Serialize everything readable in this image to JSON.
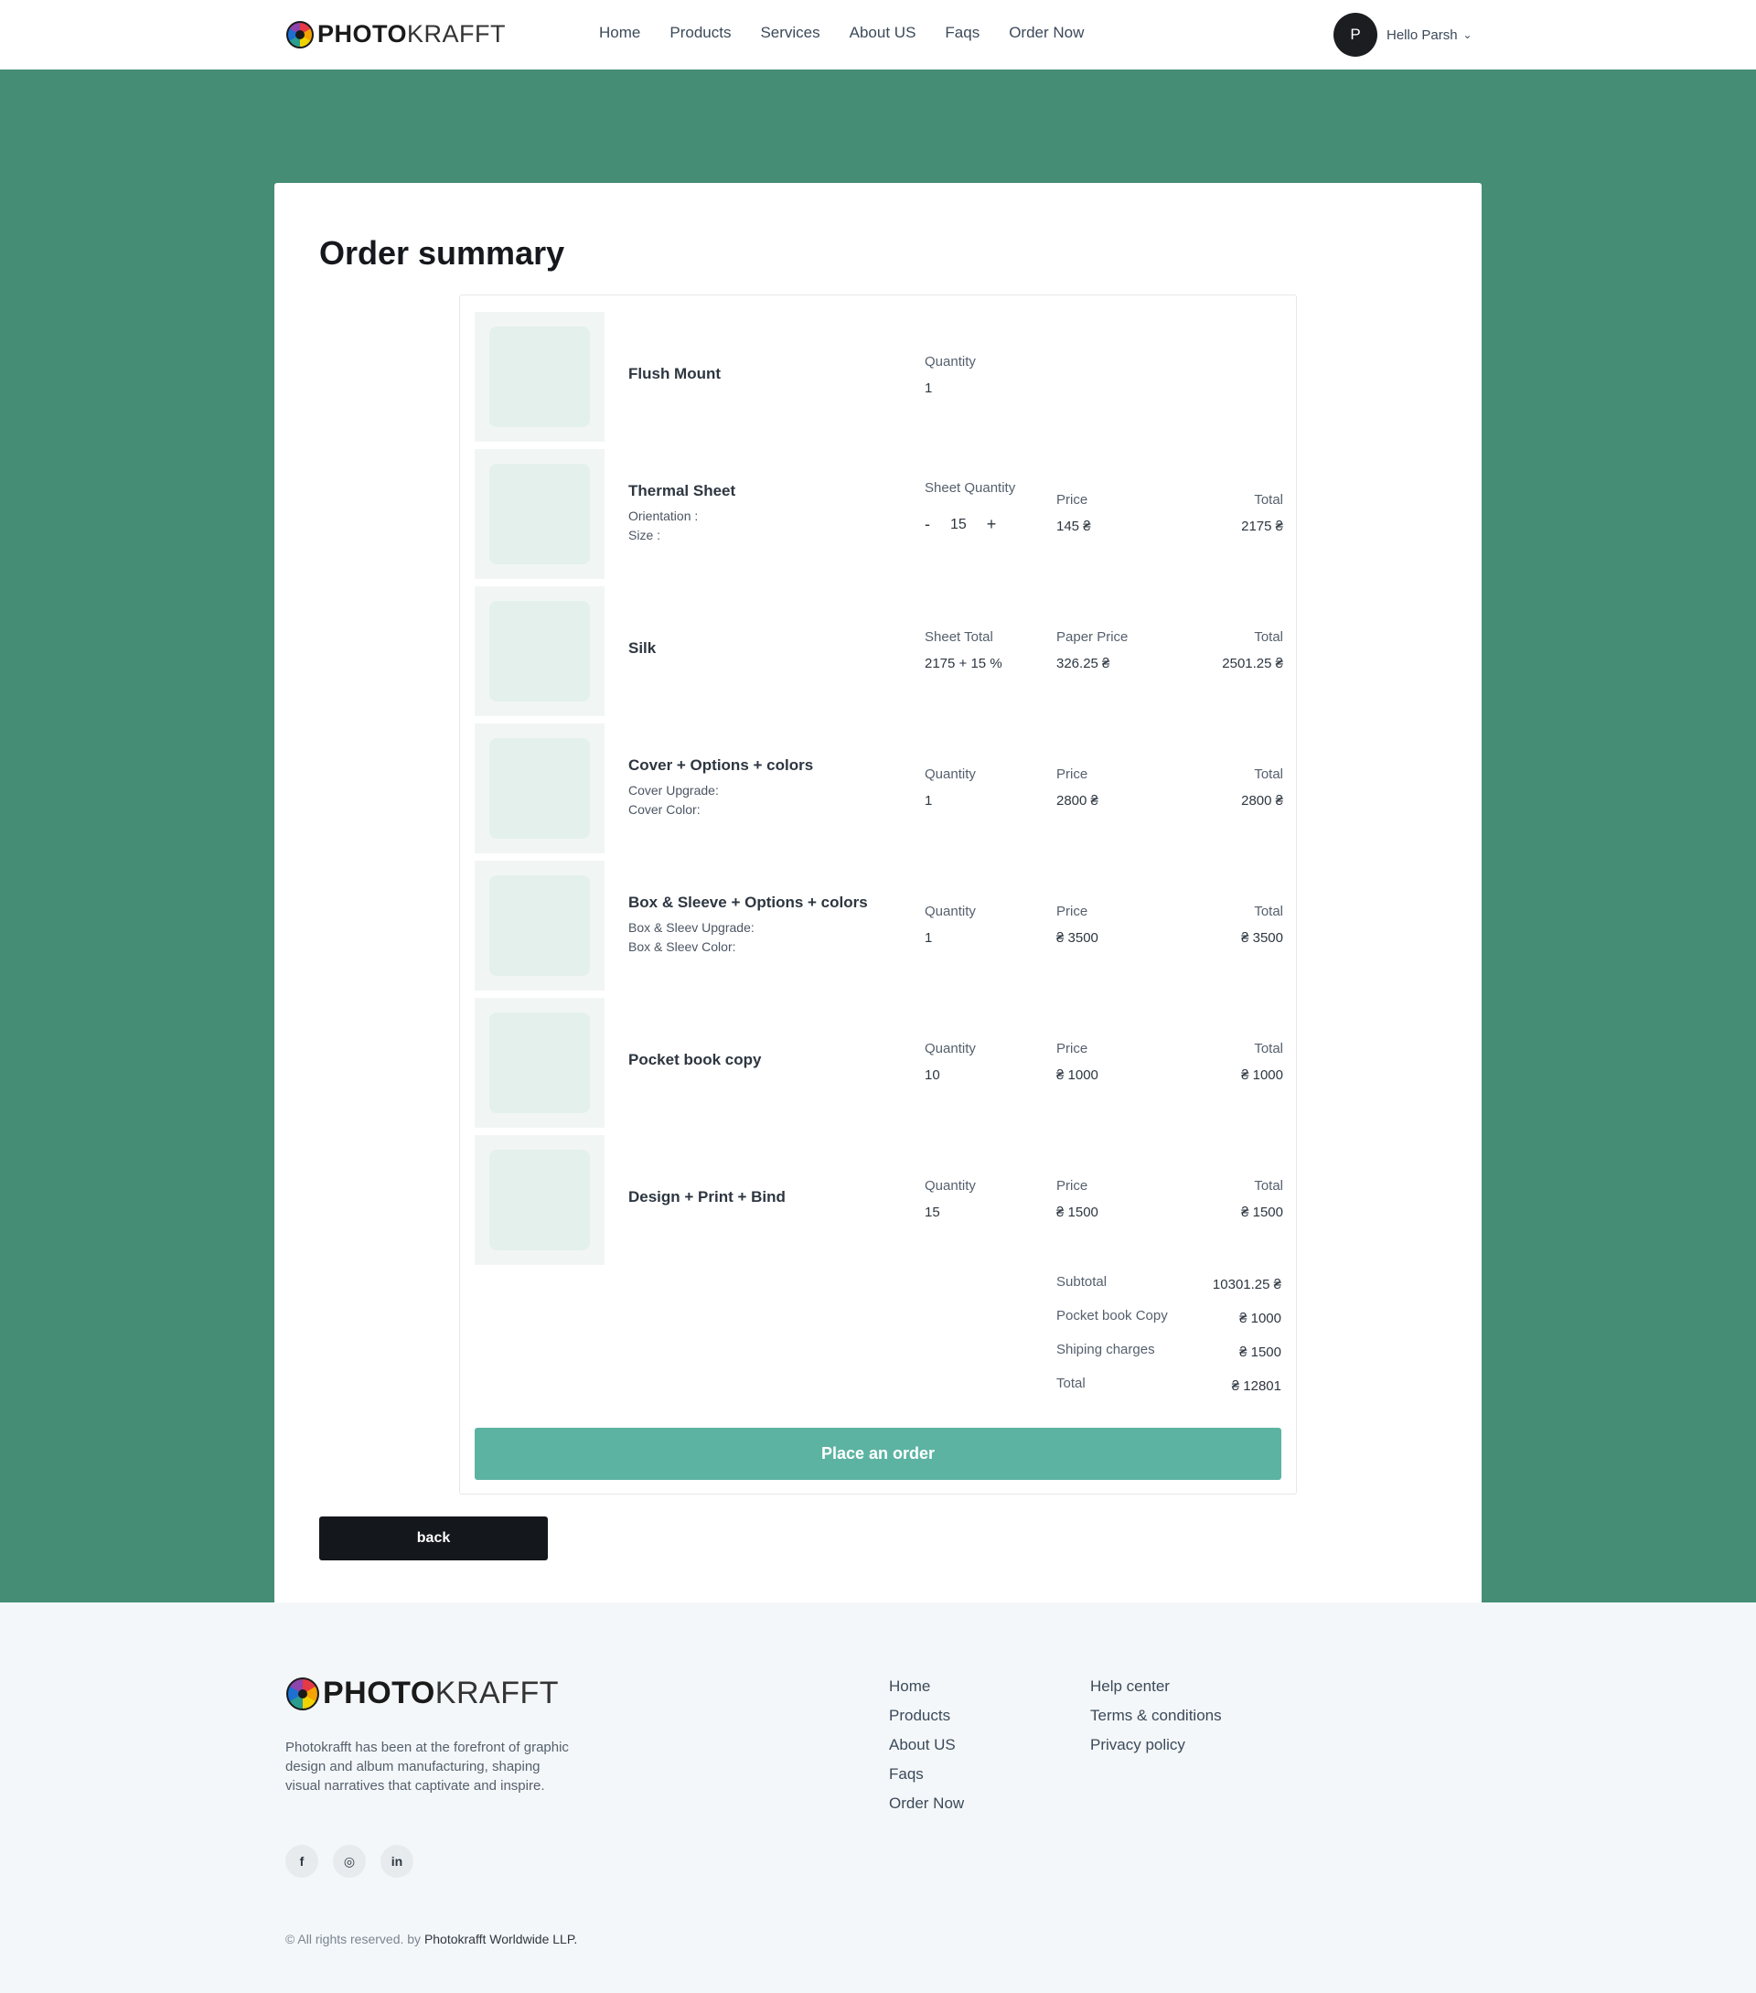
{
  "brand": {
    "part1": "PHOTO",
    "part2": "KRAFFT"
  },
  "nav": {
    "items": [
      "Home",
      "Products",
      "Services",
      "About US",
      "Faqs",
      "Order Now"
    ]
  },
  "user": {
    "initial": "P",
    "greeting": "Hello Parsh"
  },
  "page": {
    "title": "Order summary"
  },
  "items": [
    {
      "name": "Flush Mount",
      "labels": {
        "q": "Quantity"
      },
      "values": {
        "q": "1"
      }
    },
    {
      "name": "Thermal Sheet",
      "sub1": "Orientation :",
      "sub2": "Size :",
      "labels": {
        "q": "Sheet Quantity",
        "p": "Price",
        "t": "Total"
      },
      "values": {
        "q": "15",
        "p": "145 ₴",
        "t": "2175 ₴"
      },
      "stepper": {
        "minus": "-",
        "plus": "+"
      }
    },
    {
      "name": "Silk",
      "labels": {
        "q": "Sheet Total",
        "p": "Paper Price",
        "t": "Total"
      },
      "values": {
        "q": "2175 + 15 %",
        "p": "326.25 ₴",
        "t": "2501.25 ₴"
      }
    },
    {
      "name": "Cover + Options + colors",
      "sub1": "Cover Upgrade:",
      "sub2": "Cover Color:",
      "labels": {
        "q": "Quantity",
        "p": "Price",
        "t": "Total"
      },
      "values": {
        "q": "1",
        "p": "2800 ₴",
        "t": "2800 ₴"
      }
    },
    {
      "name": "Box & Sleeve + Options + colors",
      "sub1": "Box & Sleev Upgrade:",
      "sub2": "Box & Sleev Color:",
      "labels": {
        "q": "Quantity",
        "p": "Price",
        "t": "Total"
      },
      "values": {
        "q": "1",
        "p": "₴ 3500",
        "t": "₴ 3500"
      }
    },
    {
      "name": "Pocket book copy",
      "labels": {
        "q": "Quantity",
        "p": "Price",
        "t": "Total"
      },
      "values": {
        "q": "10",
        "p": "₴ 1000",
        "t": "₴ 1000"
      }
    },
    {
      "name": "Design + Print + Bind",
      "labels": {
        "q": "Quantity",
        "p": "Price",
        "t": "Total"
      },
      "values": {
        "q": "15",
        "p": "₴ 1500",
        "t": "₴ 1500"
      }
    }
  ],
  "totals": [
    {
      "label": "Subtotal",
      "value": "10301.25 ₴"
    },
    {
      "label": "Pocket book Copy",
      "value": "₴ 1000"
    },
    {
      "label": "Shiping charges",
      "value": "₴ 1500"
    },
    {
      "label": "Total",
      "value": "₴ 12801"
    }
  ],
  "actions": {
    "place_order": "Place an order",
    "back": "back"
  },
  "footer": {
    "description": "Photokrafft has been at the forefront of graphic design and album manufacturing, shaping visual narratives that captivate and inspire.",
    "social": {
      "facebook": "f",
      "instagram": "◎",
      "linkedin": "in"
    },
    "col1": [
      "Home",
      "Products",
      "About US",
      "Faqs",
      "Order Now"
    ],
    "col2": [
      "Help center",
      "Terms & conditions",
      "Privacy policy"
    ],
    "copyright_prefix": "© All rights reserved. by ",
    "copyright_company": "Photokrafft Worldwide LLP."
  },
  "colors": {
    "band": "#458d74",
    "button": "#5cb3a2",
    "dark": "#14171b"
  }
}
